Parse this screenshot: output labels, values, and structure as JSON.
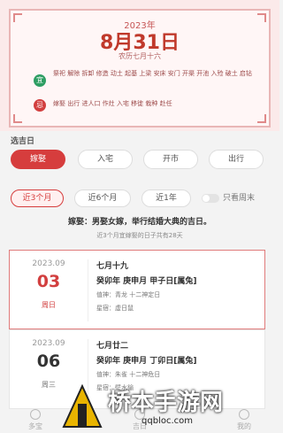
{
  "header": {
    "year_label": "2023年",
    "date": "8月31日",
    "lunar_date": "农历七月十六",
    "yi_badge": "宜",
    "yi_list": "祭祀 解除 拆卸 修造 动土 起基 上梁 安床 安门 开渠 开池 入殓 破土 启钻",
    "ji_badge": "忌",
    "ji_list": "嫁娶 出行 进人口 作灶 入宅 移徙 栽种 赴任"
  },
  "section_title": "选吉日",
  "categories": [
    "嫁娶",
    "入宅",
    "开市",
    "出行"
  ],
  "ranges": [
    "近3个月",
    "近6个月",
    "近1年"
  ],
  "weekend_toggle_label": "只看周末",
  "description": "嫁娶：男娶女嫁，举行结婚大典的吉日。",
  "count_text": "近3个月宜嫁娶的日子共有28天",
  "days": [
    {
      "year_month": "2023.09",
      "day": "03",
      "weekday": "周日",
      "lunar": "七月十九",
      "ganzhi": "癸卯年 庚申月 甲子日[属兔]",
      "duty": "值神：青龙    十二神定日",
      "star": "星宿：虚日鼠"
    },
    {
      "year_month": "2023.09",
      "day": "06",
      "weekday": "周三",
      "lunar": "七月廿二",
      "ganzhi": "癸卯年 庚申月 丁卯日[属兔]",
      "duty": "值神：朱雀    十二神危日",
      "star": "星宿：壁水貐"
    }
  ],
  "tabs": [
    "多宝",
    "吉日",
    "我的"
  ],
  "watermark": {
    "text": "桥本手游网",
    "url": "qqbloc.com"
  }
}
